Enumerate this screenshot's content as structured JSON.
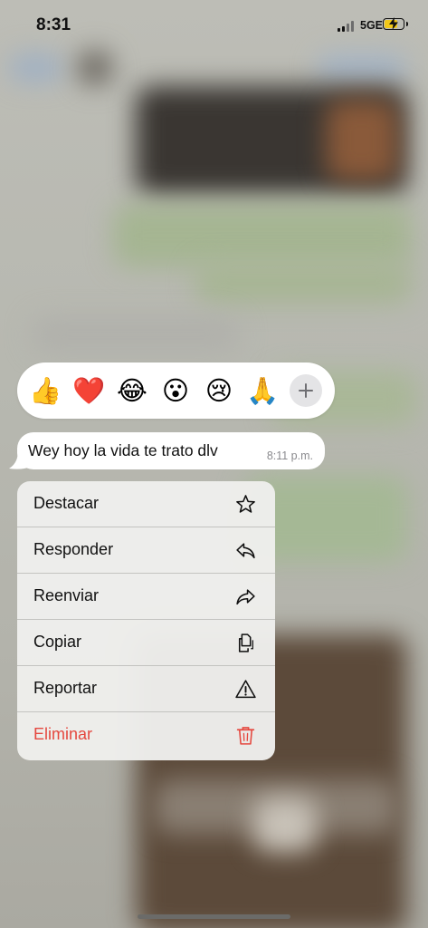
{
  "status_bar": {
    "time": "8:31",
    "network": "5GE",
    "battery_charging": true
  },
  "reactions": {
    "items": [
      {
        "emoji": "👍",
        "icon": "thumbs-up"
      },
      {
        "emoji": "❤️",
        "icon": "heart"
      },
      {
        "emoji": "😂",
        "icon": "tears-of-joy"
      },
      {
        "emoji": "😮",
        "icon": "surprised-face"
      },
      {
        "emoji": "😢",
        "icon": "crying-face"
      },
      {
        "emoji": "🙏",
        "icon": "folded-hands"
      }
    ],
    "more_icon": "plus-icon"
  },
  "message": {
    "text": "Wey hoy la vida te trato dlv",
    "time": "8:11 p.m."
  },
  "menu": {
    "items": [
      {
        "label": "Destacar",
        "icon": "star-icon"
      },
      {
        "label": "Responder",
        "icon": "reply-icon"
      },
      {
        "label": "Reenviar",
        "icon": "forward-icon"
      },
      {
        "label": "Copiar",
        "icon": "copy-icon"
      },
      {
        "label": "Reportar",
        "icon": "warning-icon"
      },
      {
        "label": "Eliminar",
        "icon": "trash-icon",
        "color": "#e5483f"
      }
    ]
  },
  "colors": {
    "danger": "#e5483f",
    "bubble": "#ffffff",
    "battery_fill": "#f2c819"
  }
}
